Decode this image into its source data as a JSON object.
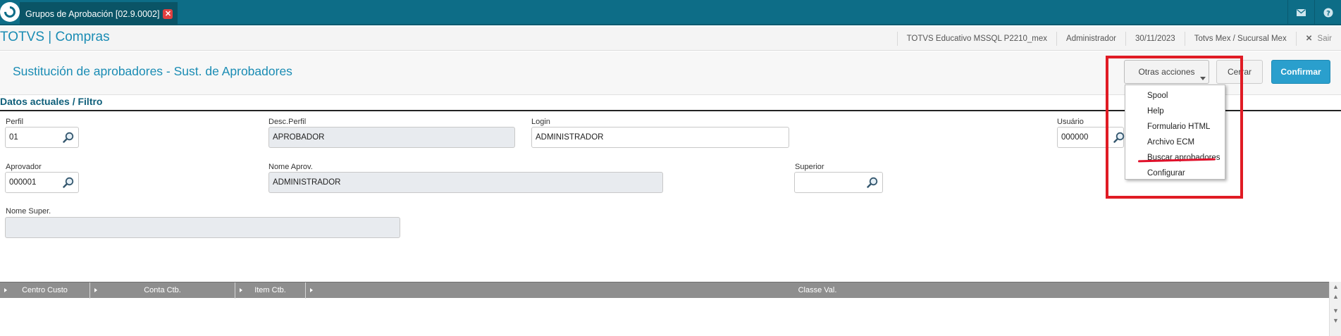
{
  "topbar": {
    "tab_title": "Grupos de Aprobación [02.9.0002]",
    "tab_close": "✕",
    "mail_icon": "mail-icon",
    "help_icon": "help-icon"
  },
  "header": {
    "brand": "TOTVS | Compras",
    "environment": "TOTVS Educativo MSSQL P2210_mex",
    "user": "Administrador",
    "date": "30/11/2023",
    "branch": "Totvs Mex / Sucursal Mex",
    "logout": "Sair",
    "logout_icon": "close-icon"
  },
  "page": {
    "title": "Sustitución de aprobadores - Sust. de Aprobadores"
  },
  "toolbar": {
    "otras_acciones": "Otras acciones",
    "cerrar": "Cerrar",
    "confirmar": "Confirmar"
  },
  "menu": {
    "items": [
      "Spool",
      "Help",
      "Formulario HTML",
      "Archivo ECM",
      "Buscar aprobadores",
      "Configurar"
    ]
  },
  "section": {
    "title": "Datos actuales / Filtro"
  },
  "form": {
    "perfil": {
      "label": "Perfil",
      "value": "01"
    },
    "desc_perfil": {
      "label": "Desc.Perfil",
      "value": "APROBADOR"
    },
    "login": {
      "label": "Login",
      "value": "ADMINISTRADOR"
    },
    "usuario": {
      "label": "Usuário",
      "value": "000000"
    },
    "aprovador": {
      "label": "Aprovador",
      "value": "000001"
    },
    "nome_aprov": {
      "label": "Nome Aprov.",
      "value": "ADMINISTRADOR"
    },
    "superior": {
      "label": "Superior",
      "value": ""
    },
    "nome_super": {
      "label": "Nome Super.",
      "value": ""
    }
  },
  "grid": {
    "columns": [
      "Centro Custo",
      "Conta Ctb.",
      "Item Ctb.",
      "Classe Val."
    ]
  },
  "colors": {
    "topbar": "#0d6d87",
    "accent": "#1a8cb4",
    "confirm": "#2a9fcd",
    "highlight": "#e01b24"
  }
}
